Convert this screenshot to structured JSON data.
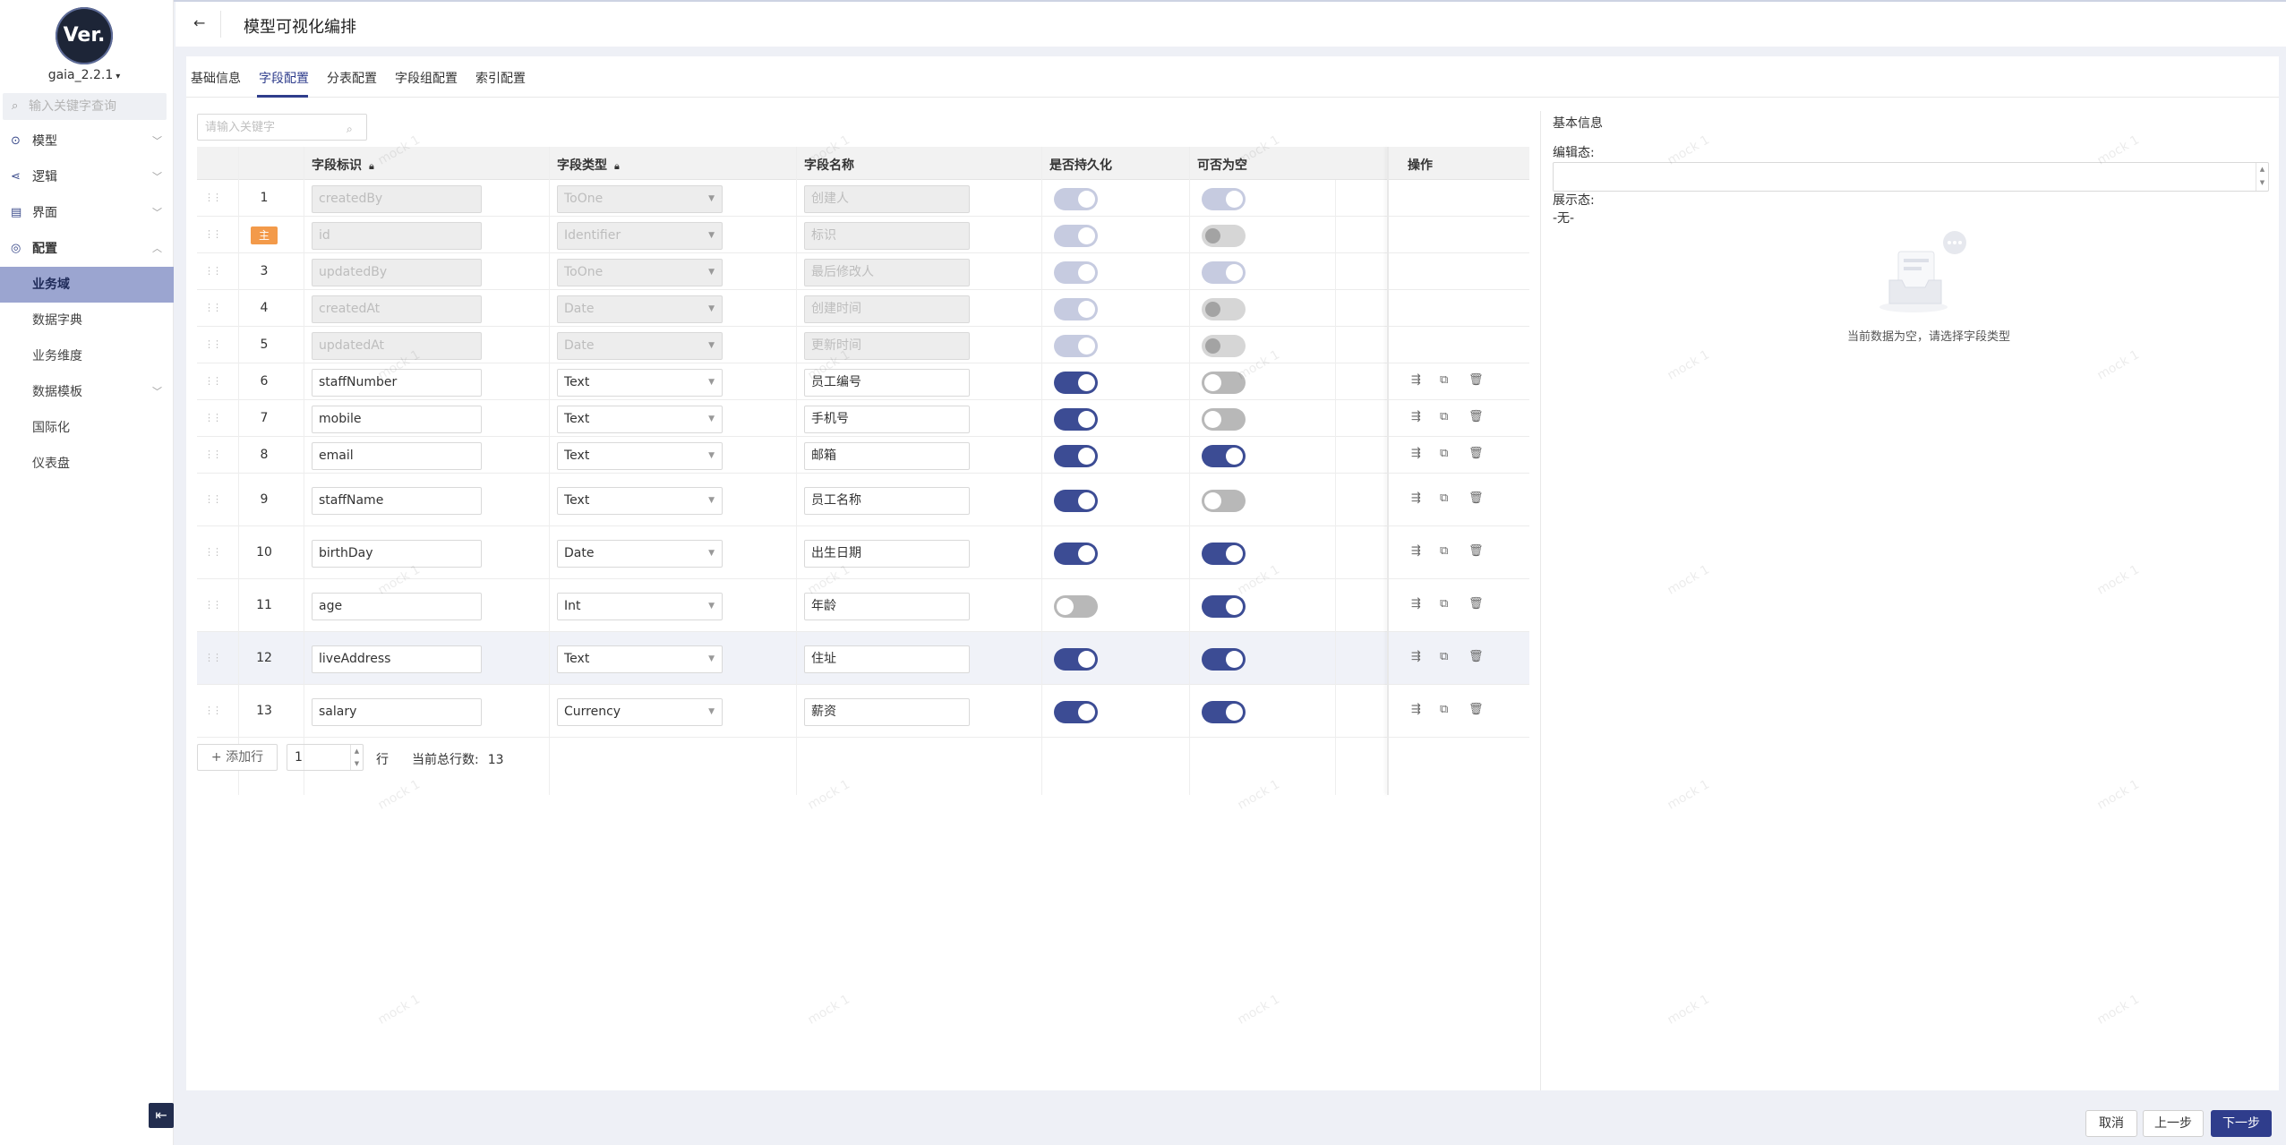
{
  "app": {
    "logo_text": "Ver.",
    "version": "gaia_2.2.1"
  },
  "sidebar": {
    "search_placeholder": "输入关键字查询",
    "items": [
      {
        "label": "模型",
        "icon": "model-icon"
      },
      {
        "label": "逻辑",
        "icon": "logic-icon"
      },
      {
        "label": "界面",
        "icon": "ui-icon"
      },
      {
        "label": "配置",
        "icon": "config-icon"
      }
    ],
    "sub_items": [
      "业务域",
      "数据字典",
      "业务维度",
      "数据模板",
      "国际化",
      "仪表盘"
    ],
    "active_sub": "业务域"
  },
  "header": {
    "back_icon": "arrow-left-icon",
    "title": "模型可视化编排"
  },
  "tabs": [
    "基础信息",
    "字段配置",
    "分表配置",
    "字段组配置",
    "索引配置"
  ],
  "active_tab": "字段配置",
  "table": {
    "search_placeholder": "请输入关键字",
    "columns": [
      "字段标识",
      "字段类型",
      "字段名称",
      "是否持久化",
      "可否为空",
      "操作"
    ],
    "pk_badge": "主",
    "rows": [
      {
        "index": "1",
        "id": "createdBy",
        "type": "ToOne",
        "name": "创建人",
        "persist": true,
        "nullable": true,
        "system": true
      },
      {
        "index": "2",
        "id": "id",
        "type": "Identifier",
        "name": "标识",
        "persist": true,
        "nullable": false,
        "system": true,
        "pk": true
      },
      {
        "index": "3",
        "id": "updatedBy",
        "type": "ToOne",
        "name": "最后修改人",
        "persist": true,
        "nullable": true,
        "system": true
      },
      {
        "index": "4",
        "id": "createdAt",
        "type": "Date",
        "name": "创建时间",
        "persist": true,
        "nullable": false,
        "system": true
      },
      {
        "index": "5",
        "id": "updatedAt",
        "type": "Date",
        "name": "更新时间",
        "persist": true,
        "nullable": false,
        "system": true
      },
      {
        "index": "6",
        "id": "staffNumber",
        "type": "Text",
        "name": "员工编号",
        "persist": true,
        "nullable": false
      },
      {
        "index": "7",
        "id": "mobile",
        "type": "Text",
        "name": "手机号",
        "persist": true,
        "nullable": false
      },
      {
        "index": "8",
        "id": "email",
        "type": "Text",
        "name": "邮箱",
        "persist": true,
        "nullable": true
      },
      {
        "index": "9",
        "id": "staffName",
        "type": "Text",
        "name": "员工名称",
        "persist": true,
        "nullable": false
      },
      {
        "index": "10",
        "id": "birthDay",
        "type": "Date",
        "name": "出生日期",
        "persist": true,
        "nullable": true
      },
      {
        "index": "11",
        "id": "age",
        "type": "Int",
        "name": "年龄",
        "persist": false,
        "nullable": true
      },
      {
        "index": "12",
        "id": "liveAddress",
        "type": "Text",
        "name": "住址",
        "persist": true,
        "nullable": true
      },
      {
        "index": "13",
        "id": "salary",
        "type": "Currency",
        "name": "薪资",
        "persist": true,
        "nullable": true
      }
    ],
    "add_row_label": "+ 添加行",
    "add_count": "1",
    "row_unit": "行",
    "total_label": "当前总行数:",
    "total_count": "13"
  },
  "panel": {
    "title": "基本信息",
    "edit_label": "编辑态:",
    "display_label": "展示态:",
    "display_value": "-无-",
    "empty_text": "当前数据为空，请选择字段类型"
  },
  "footer": {
    "cancel": "取消",
    "prev": "上一步",
    "next": "下一步"
  },
  "watermark": "mock 1",
  "colors": {
    "primary": "#2f3d8c",
    "toggle_on": "#3c4c94",
    "pk_badge": "#f39a4a",
    "active_menu": "#9ba5d0"
  }
}
